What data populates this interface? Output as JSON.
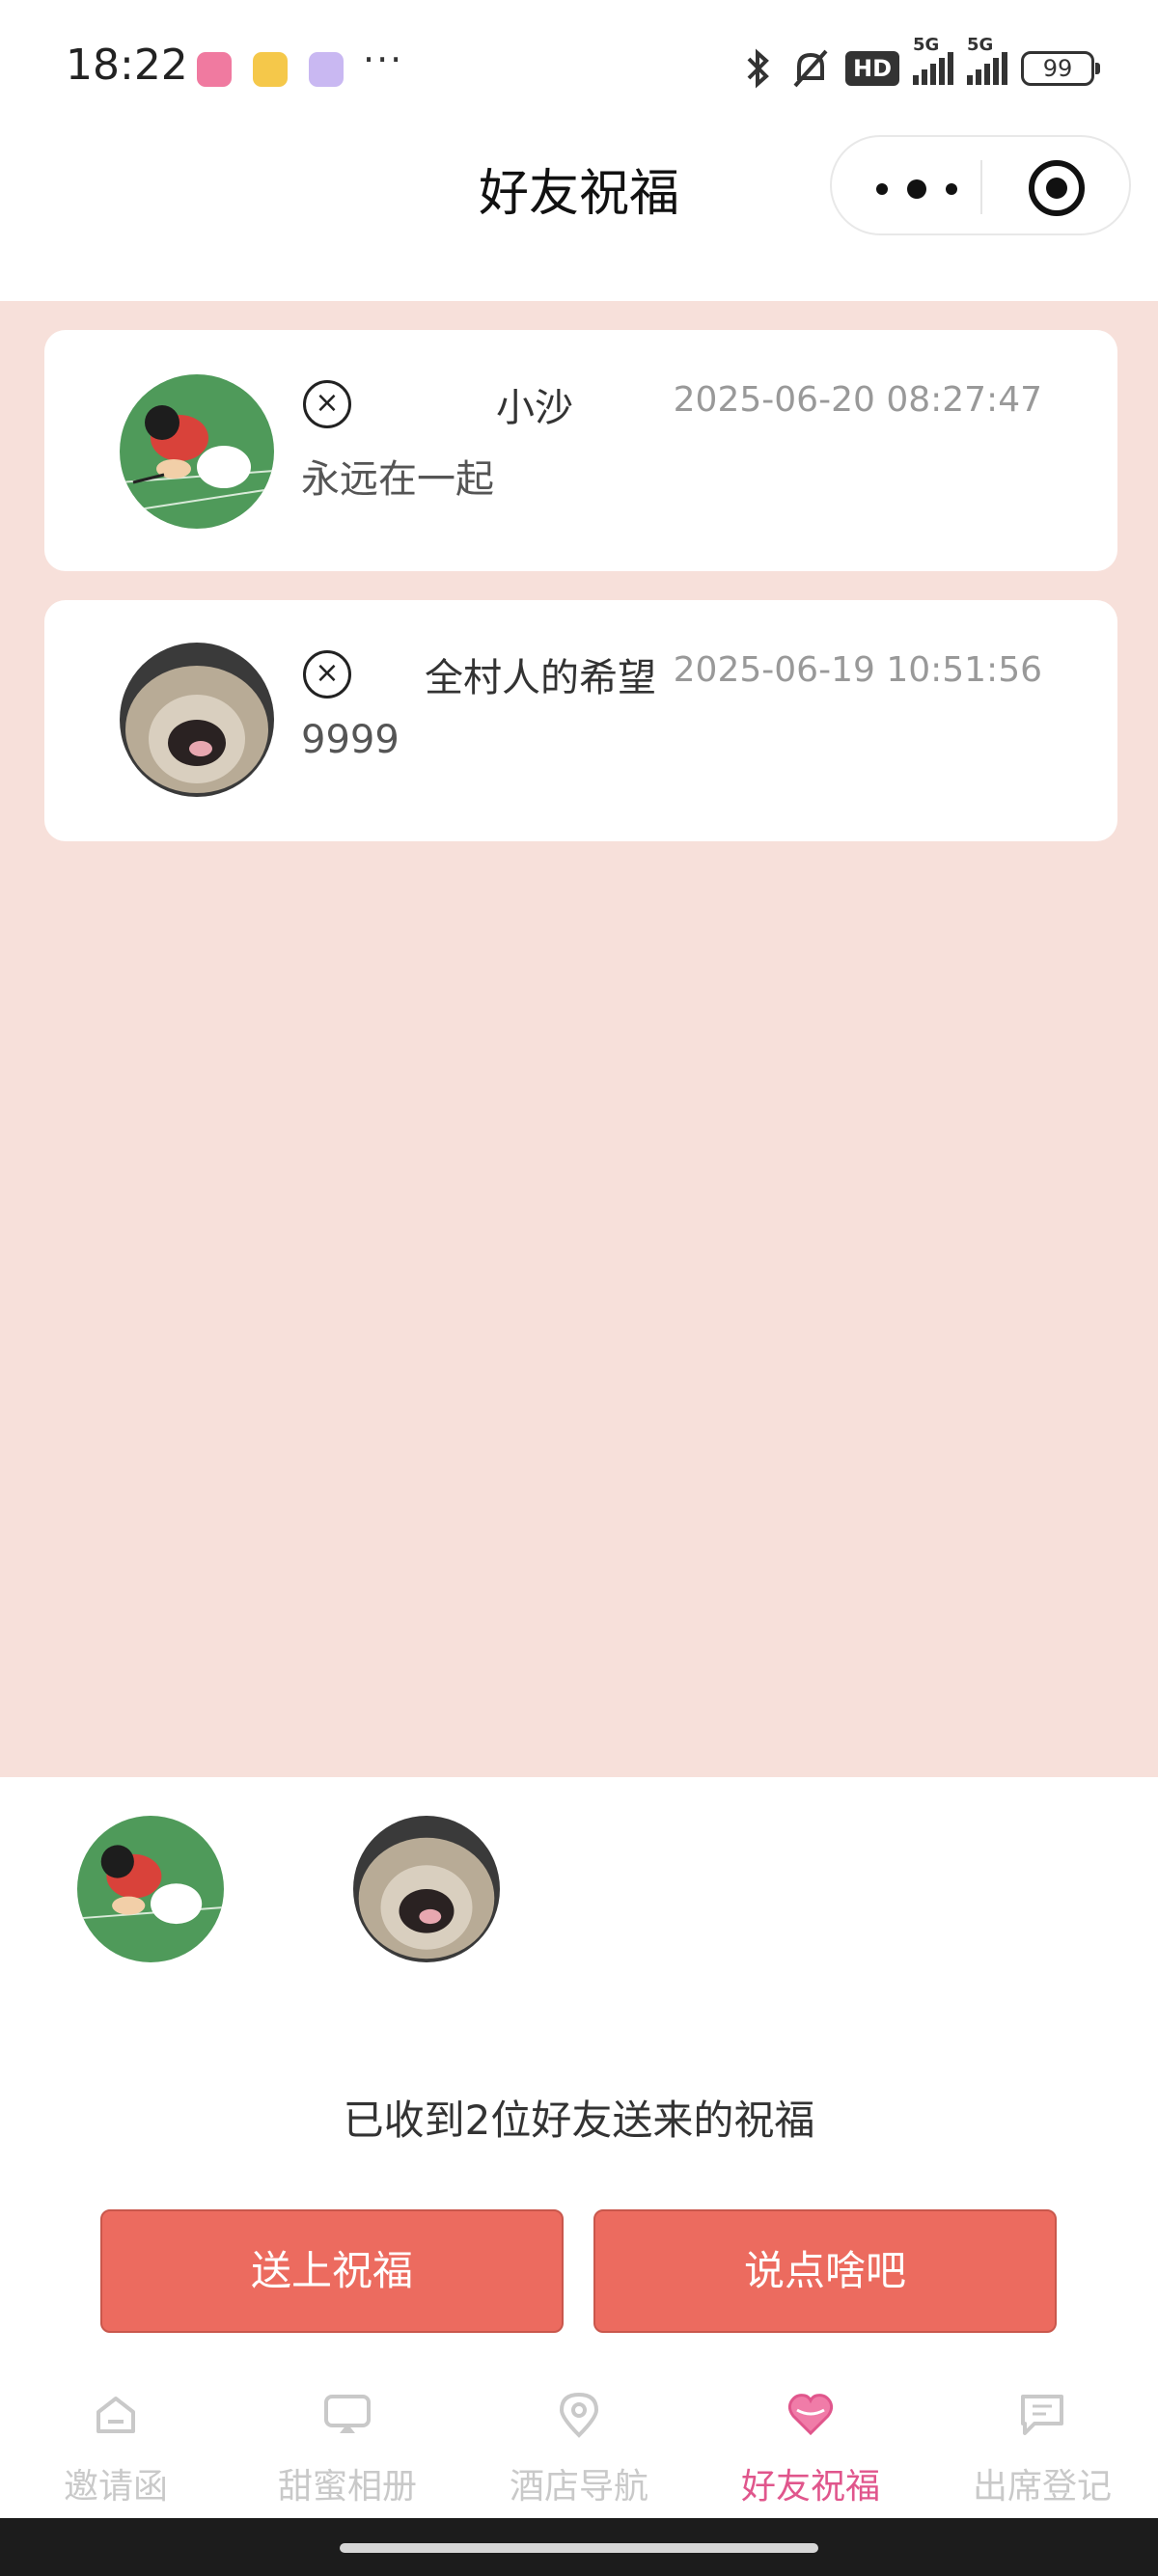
{
  "status_bar": {
    "time": "18:22",
    "more": "···",
    "hd": "HD",
    "net1": "5G",
    "net2": "5G",
    "battery": "99"
  },
  "navbar": {
    "title": "好友祝福"
  },
  "blessings": [
    {
      "name": "小沙",
      "time": "2025-06-20 08:27:47",
      "message": "永远在一起",
      "delete_icon": "×"
    },
    {
      "name": "全村人的希望",
      "time": "2025-06-19 10:51:56",
      "message": "9999",
      "delete_icon": "×"
    }
  ],
  "summary": "已收到2位好友送来的祝福",
  "actions": {
    "send_blessing": "送上祝福",
    "say_something": "说点啥吧"
  },
  "tabs": [
    {
      "label": "邀请函",
      "icon": "home-icon"
    },
    {
      "label": "甜蜜相册",
      "icon": "album-icon"
    },
    {
      "label": "酒店导航",
      "icon": "location-icon"
    },
    {
      "label": "好友祝福",
      "icon": "heart-icon",
      "active": true
    },
    {
      "label": "出席登记",
      "icon": "message-icon"
    }
  ],
  "colors": {
    "content_bg": "#f7e0da",
    "button": "#ec6b5f",
    "active_tab": "#e0568c",
    "inactive_tab": "#c9c9c9"
  }
}
